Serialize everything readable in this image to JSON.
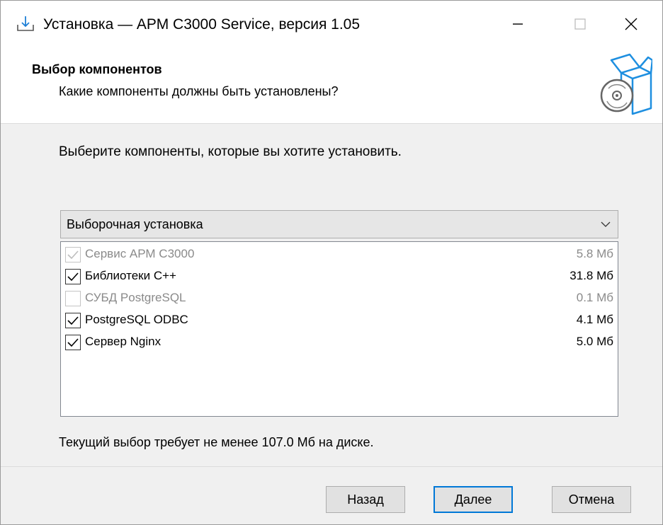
{
  "window": {
    "title": "Установка — АРМ С3000 Service, версия 1.05"
  },
  "header": {
    "title": "Выбор компонентов",
    "subtitle": "Какие компоненты должны быть установлены?"
  },
  "main": {
    "instruction": "Выберите компоненты, которые вы хотите установить.",
    "install_type": {
      "selected": "Выборочная установка"
    },
    "components": [
      {
        "name": "Сервис АРМ С3000",
        "size": "5.8 Мб",
        "checked": true,
        "disabled": true
      },
      {
        "name": "Библиотеки C++",
        "size": "31.8 Мб",
        "checked": true,
        "disabled": false
      },
      {
        "name": "СУБД PostgreSQL",
        "size": "0.1 Мб",
        "checked": false,
        "disabled": true
      },
      {
        "name": "PostgreSQL ODBC",
        "size": "4.1 Мб",
        "checked": true,
        "disabled": false
      },
      {
        "name": "Сервер Nginx",
        "size": "5.0 Мб",
        "checked": true,
        "disabled": false
      }
    ],
    "disk_requirement": "Текущий выбор требует не менее 107.0 Мб на диске."
  },
  "footer": {
    "back_label": "Назад",
    "next_label": "Далее",
    "cancel_label": "Отмена"
  },
  "icons": {
    "app": "download-icon",
    "header": "software-box-cd-icon",
    "minimize": "minimize-icon",
    "maximize": "maximize-icon",
    "close": "close-icon",
    "dropdown": "chevron-down-icon",
    "check": "check-icon"
  },
  "colors": {
    "accent": "#0078d7",
    "disabled_text": "#8a8a8a"
  }
}
